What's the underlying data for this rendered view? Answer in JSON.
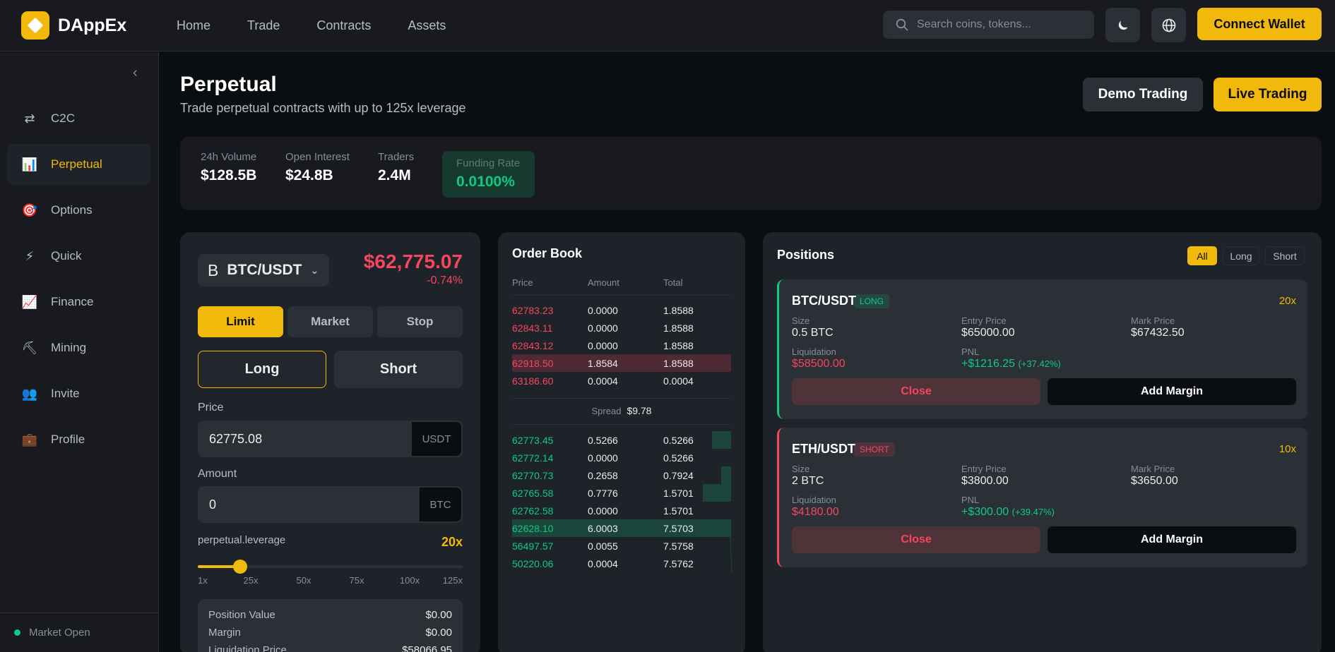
{
  "app": {
    "name": "DAppEx"
  },
  "nav": [
    {
      "label": "Home"
    },
    {
      "label": "Trade"
    },
    {
      "label": "Contracts"
    },
    {
      "label": "Assets"
    }
  ],
  "search": {
    "placeholder": "Search coins, tokens..."
  },
  "header": {
    "connect_label": "Connect Wallet"
  },
  "sidebar": {
    "items": [
      {
        "label": "C2C",
        "icon": "exchange-icon",
        "glyph": "⇄"
      },
      {
        "label": "Perpetual",
        "icon": "chart-icon",
        "glyph": "📊",
        "active": true
      },
      {
        "label": "Options",
        "icon": "target-icon",
        "glyph": "🎯"
      },
      {
        "label": "Quick",
        "icon": "lightning-icon",
        "glyph": "⚡"
      },
      {
        "label": "Finance",
        "icon": "trend-chart-icon",
        "glyph": "📈"
      },
      {
        "label": "Mining",
        "icon": "pickaxe-icon",
        "glyph": "⛏"
      },
      {
        "label": "Invite",
        "icon": "users-icon",
        "glyph": "👥"
      },
      {
        "label": "Profile",
        "icon": "briefcase-icon",
        "glyph": "💼"
      }
    ],
    "status": "Market Open"
  },
  "page": {
    "title": "Perpetual",
    "subtitle": "Trade perpetual contracts with up to 125x leverage",
    "demo_label": "Demo Trading",
    "live_label": "Live Trading"
  },
  "stats": [
    {
      "label": "24h Volume",
      "value": "$128.5B"
    },
    {
      "label": "Open Interest",
      "value": "$24.8B"
    },
    {
      "label": "Traders",
      "value": "2.4M"
    },
    {
      "label": "Funding Rate",
      "value": "0.0100%"
    }
  ],
  "trade": {
    "coin_glyph": "B",
    "pair": "BTC/USDT",
    "price": "$62,775.07",
    "change": "-0.74%",
    "order_types": [
      "Limit",
      "Market",
      "Stop"
    ],
    "active_order_type": "Limit",
    "sides": [
      "Long",
      "Short"
    ],
    "active_side": "Long",
    "price_label": "Price",
    "price_value": "62775.08",
    "price_unit": "USDT",
    "amount_label": "Amount",
    "amount_value": "0",
    "amount_unit": "BTC",
    "leverage_label": "perpetual.leverage",
    "leverage_value": "20x",
    "leverage_fraction": 0.16,
    "leverage_ticks": [
      "1x",
      "25x",
      "50x",
      "75x",
      "100x",
      "125x"
    ],
    "summary": [
      {
        "label": "Position Value",
        "value": "$0.00"
      },
      {
        "label": "Margin",
        "value": "$0.00"
      },
      {
        "label": "Liquidation Price",
        "value": "$58066.95"
      }
    ]
  },
  "order_book": {
    "title": "Order Book",
    "headers": [
      "Price",
      "Amount",
      "Total"
    ],
    "asks": [
      {
        "price": "62783.23",
        "amount": "0.0000",
        "total": "1.8588",
        "depth": 0
      },
      {
        "price": "62843.11",
        "amount": "0.0000",
        "total": "1.8588",
        "depth": 0
      },
      {
        "price": "62843.12",
        "amount": "0.0000",
        "total": "1.8588",
        "depth": 0
      },
      {
        "price": "62918.50",
        "amount": "1.8584",
        "total": "1.8588",
        "depth": 1.0
      },
      {
        "price": "63186.60",
        "amount": "0.0004",
        "total": "0.0004",
        "depth": 0
      }
    ],
    "spread_label": "Spread",
    "spread_value": "$9.78",
    "bids": [
      {
        "price": "62773.45",
        "amount": "0.5266",
        "total": "0.5266",
        "depth": 0.088
      },
      {
        "price": "62772.14",
        "amount": "0.0000",
        "total": "0.5266",
        "depth": 0
      },
      {
        "price": "62770.73",
        "amount": "0.2658",
        "total": "0.7924",
        "depth": 0.044
      },
      {
        "price": "62765.58",
        "amount": "0.7776",
        "total": "1.5701",
        "depth": 0.13
      },
      {
        "price": "62762.58",
        "amount": "0.0000",
        "total": "1.5701",
        "depth": 0
      },
      {
        "price": "62628.10",
        "amount": "6.0003",
        "total": "7.5703",
        "depth": 1.0
      },
      {
        "price": "56497.57",
        "amount": "0.0055",
        "total": "7.5758",
        "depth": 0.004
      },
      {
        "price": "50220.06",
        "amount": "0.0004",
        "total": "7.5762",
        "depth": 0.001
      }
    ]
  },
  "positions": {
    "title": "Positions",
    "filters": [
      "All",
      "Long",
      "Short"
    ],
    "active_filter": "All",
    "items": [
      {
        "pair": "BTC/USDT",
        "side": "LONG",
        "leverage": "20x",
        "size_label": "Size",
        "size": "0.5 BTC",
        "entry_label": "Entry Price",
        "entry": "$65000.00",
        "mark_label": "Mark Price",
        "mark": "$67432.50",
        "liq_label": "Liquidation",
        "liq": "$58500.00",
        "pnl_label": "PNL",
        "pnl": "+$1216.25",
        "pnl_pct": "(+37.42%)",
        "close_label": "Close",
        "margin_label": "Add Margin"
      },
      {
        "pair": "ETH/USDT",
        "side": "SHORT",
        "leverage": "10x",
        "size_label": "Size",
        "size": "2 BTC",
        "entry_label": "Entry Price",
        "entry": "$3800.00",
        "mark_label": "Mark Price",
        "mark": "$3650.00",
        "liq_label": "Liquidation",
        "liq": "$4180.00",
        "pnl_label": "PNL",
        "pnl": "+$300.00",
        "pnl_pct": "(+39.47%)",
        "close_label": "Close",
        "margin_label": "Add Margin"
      }
    ]
  }
}
